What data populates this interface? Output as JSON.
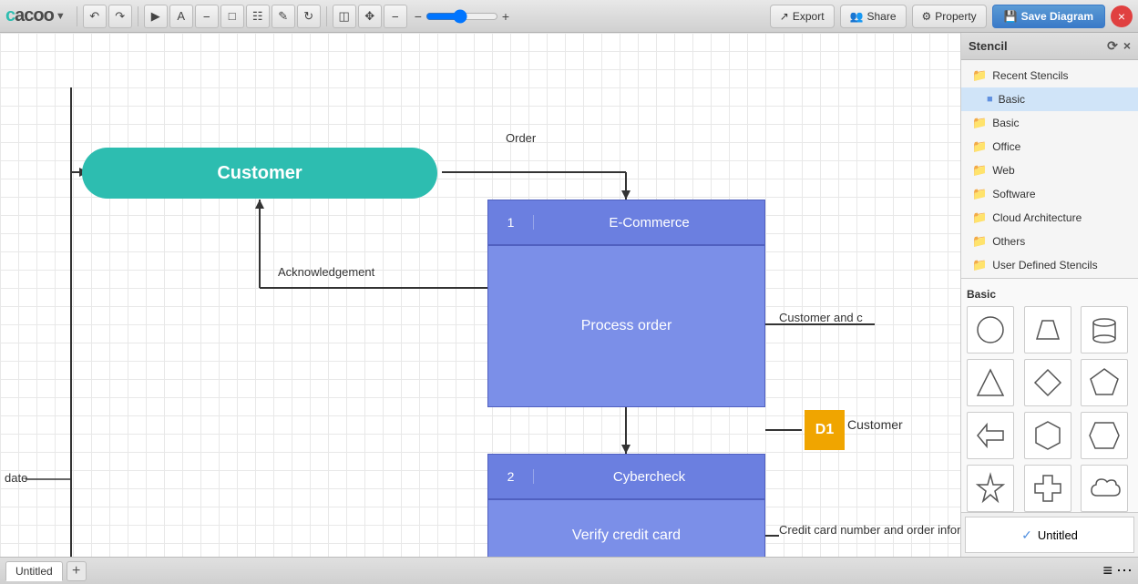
{
  "app": {
    "logo": "cacoo",
    "logo_dropdown": "▼"
  },
  "toolbar": {
    "zoom_value": "",
    "export_label": "Export",
    "share_label": "Share",
    "property_label": "Property",
    "save_label": "Save Diagram",
    "close_label": "×"
  },
  "diagram": {
    "customer_label": "Customer",
    "order_label": "Order",
    "acknowledgement_label": "Acknowledgement",
    "ecommerce_num": "1",
    "ecommerce_title": "E-Commerce",
    "process_order_label": "Process order",
    "cybercheck_num": "2",
    "cybercheck_title": "Cybercheck",
    "verify_label": "Verify credit card",
    "d1_label": "D1",
    "customer_d1": "Customer",
    "cc_label": "Credit card number and order informatio",
    "customer_and": "Customer and c"
  },
  "stencil": {
    "title": "Stencil",
    "refresh_icon": "⟳",
    "close_icon": "×",
    "items": [
      {
        "label": "Recent Stencils",
        "type": "section",
        "icon": "folder"
      },
      {
        "label": "Basic",
        "type": "sub",
        "icon": "basic"
      },
      {
        "label": "Basic",
        "type": "item",
        "icon": "folder"
      },
      {
        "label": "Office",
        "type": "item",
        "icon": "folder"
      },
      {
        "label": "Web",
        "type": "item",
        "icon": "folder"
      },
      {
        "label": "Software",
        "type": "item",
        "icon": "folder"
      },
      {
        "label": "Cloud Architecture",
        "type": "item",
        "icon": "folder"
      },
      {
        "label": "Others",
        "type": "item",
        "icon": "folder"
      },
      {
        "label": "User Defined Stencils",
        "type": "item",
        "icon": "folder"
      }
    ],
    "shapes_section_label": "Basic",
    "shapes": [
      "circle",
      "trapezoid",
      "cylinder",
      "triangle",
      "diamond",
      "pentagon",
      "arrow",
      "hexagon",
      "heptagon",
      "star",
      "cross",
      "cloud"
    ]
  },
  "bottombar": {
    "tab_label": "Untitled",
    "add_label": "+",
    "hamburger": "≡",
    "dots": "⋯"
  }
}
